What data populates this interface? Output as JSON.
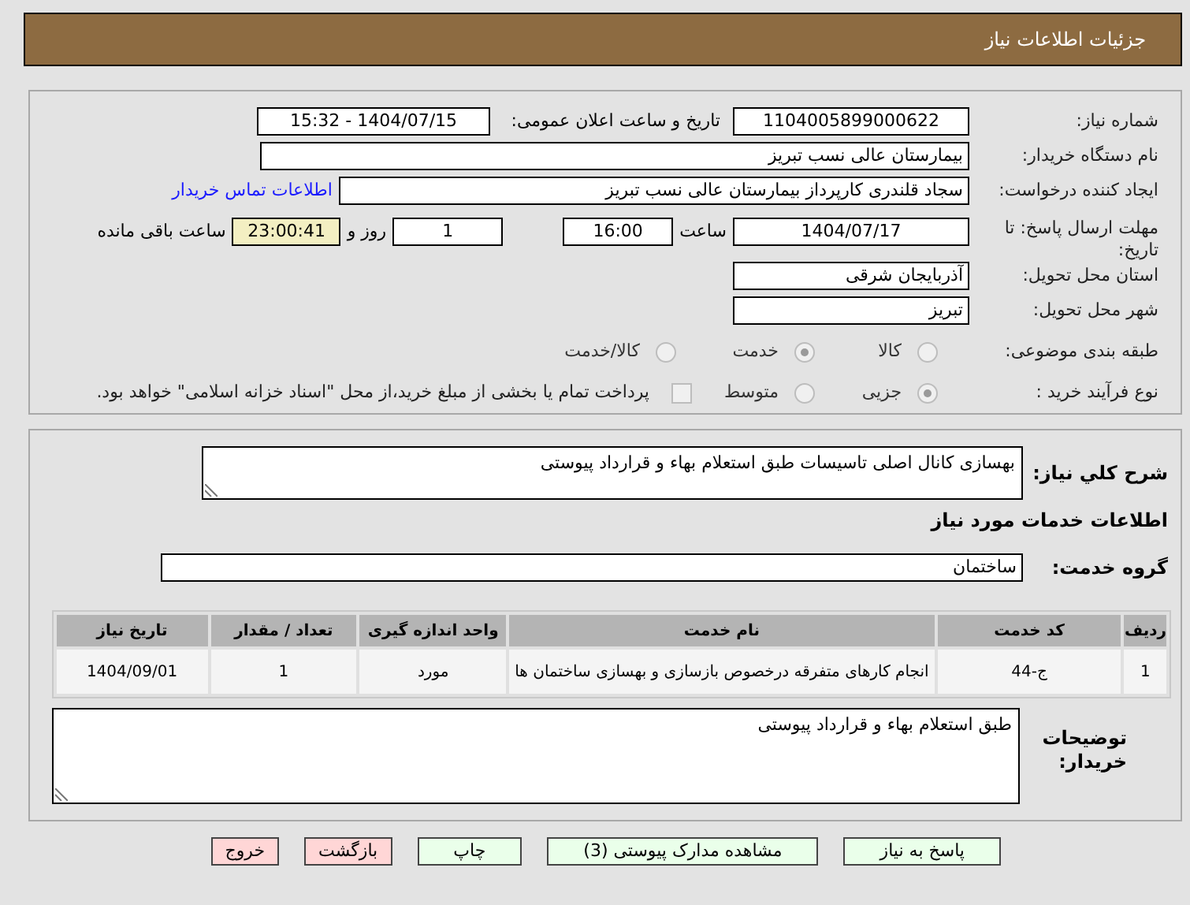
{
  "header": {
    "title": "جزئیات اطلاعات نیاز"
  },
  "need_number": {
    "label": "شماره نیاز:",
    "value": "1104005899000622"
  },
  "announce": {
    "label": "تاریخ و ساعت اعلان عمومی:",
    "value": "1404/07/15 - 15:32"
  },
  "buyer_org": {
    "label": "نام دستگاه خریدار:",
    "value": "بیمارستان عالی نسب تبریز"
  },
  "creator": {
    "label": "ایجاد کننده درخواست:",
    "value": "سجاد قلندری کارپرداز بیمارستان عالی نسب تبریز",
    "link": "اطلاعات تماس خریدار"
  },
  "deadline": {
    "label": "مهلت ارسال پاسخ: تا تاریخ:",
    "date": "1404/07/17",
    "time_label": "ساعت",
    "time": "16:00",
    "days": "1",
    "days_label": "روز و",
    "remaining": "23:00:41",
    "remaining_label": "ساعت باقی مانده"
  },
  "province": {
    "label": "استان محل تحویل:",
    "value": "آذربایجان شرقی"
  },
  "city": {
    "label": "شهر محل تحویل:",
    "value": "تبریز"
  },
  "category": {
    "label": "طبقه بندی موضوعی:",
    "options": [
      {
        "label": "کالا",
        "selected": false
      },
      {
        "label": "خدمت",
        "selected": true
      },
      {
        "label": "کالا/خدمت",
        "selected": false
      }
    ]
  },
  "purchase_type": {
    "label": "نوع فرآیند خرید :",
    "options": [
      {
        "label": "جزیی",
        "selected": true
      },
      {
        "label": "متوسط",
        "selected": false
      }
    ],
    "payment_note": {
      "label": "پرداخت تمام یا بخشی از مبلغ خرید،از محل \"اسناد خزانه اسلامی\" خواهد بود.",
      "checked": false
    }
  },
  "summary": {
    "label": "شرح کلي نیاز:",
    "value": "بهسازی کانال اصلی تاسیسات طبق استعلام بهاء و قرارداد پیوستی"
  },
  "services_heading": "اطلاعات خدمات مورد نیاز",
  "service_group": {
    "label": "گروه خدمت:",
    "value": "ساختمان"
  },
  "table": {
    "columns": [
      "ردیف",
      "کد خدمت",
      "نام خدمت",
      "واحد اندازه گیری",
      "تعداد / مقدار",
      "تاریخ نیاز"
    ],
    "rows": [
      [
        "1",
        "ج-44",
        "انجام کارهای متفرقه درخصوص بازسازی و بهسازی ساختمان ها",
        "مورد",
        "1",
        "1404/09/01"
      ]
    ]
  },
  "buyer_notes": {
    "label": "توضیحات خریدار:",
    "value": "طبق استعلام بهاء و قرارداد پیوستی"
  },
  "buttons": [
    {
      "label": "پاسخ به نیاز",
      "kind": "normal"
    },
    {
      "label": "مشاهده مدارک پیوستی (3)",
      "kind": "normal"
    },
    {
      "label": "چاپ",
      "kind": "normal"
    },
    {
      "label": "بازگشت",
      "kind": "danger"
    },
    {
      "label": "خروج",
      "kind": "danger"
    }
  ]
}
